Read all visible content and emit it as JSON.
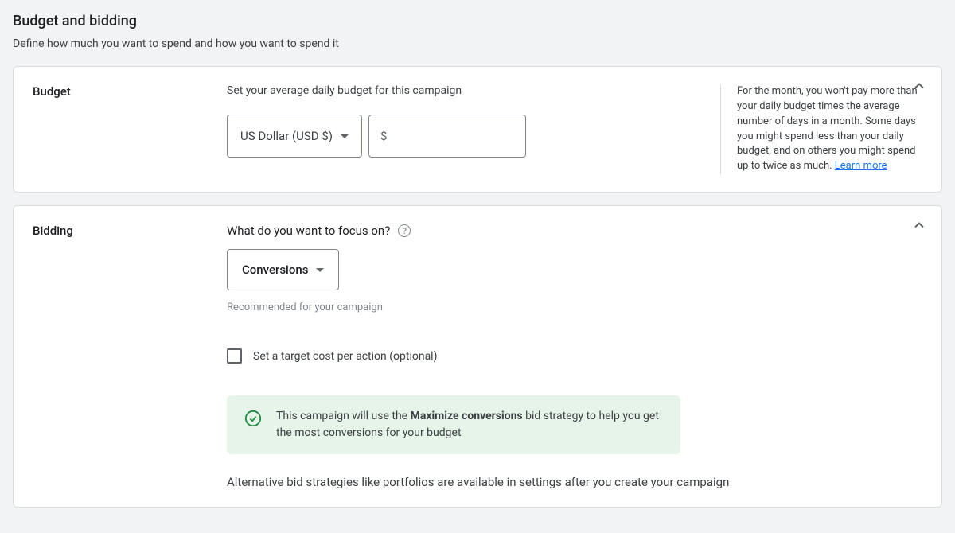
{
  "page": {
    "title": "Budget and bidding",
    "subtitle": "Define how much you want to spend and how you want to spend it"
  },
  "budget": {
    "sectionName": "Budget",
    "label": "Set your average daily budget for this campaign",
    "currencyOption": "US Dollar (USD $)",
    "currencyPrefix": "$",
    "amountValue": "",
    "infoText": "For the month, you won't pay more than your daily budget times the average number of days in a month. Some days you might spend less than your daily budget, and on others you might spend up to twice as much. ",
    "learnMore": "Learn more"
  },
  "bidding": {
    "sectionName": "Bidding",
    "focusLabel": "What do you want to focus on?",
    "focusValue": "Conversions",
    "recommended": "Recommended for your campaign",
    "checkboxLabel": "Set a target cost per action (optional)",
    "bannerTextPre": "This campaign will use the ",
    "bannerTextBold": "Maximize conversions",
    "bannerTextPost": " bid strategy to help you get the most conversions for your budget",
    "alternativeText": "Alternative bid strategies like portfolios are available in settings after you create your campaign"
  }
}
